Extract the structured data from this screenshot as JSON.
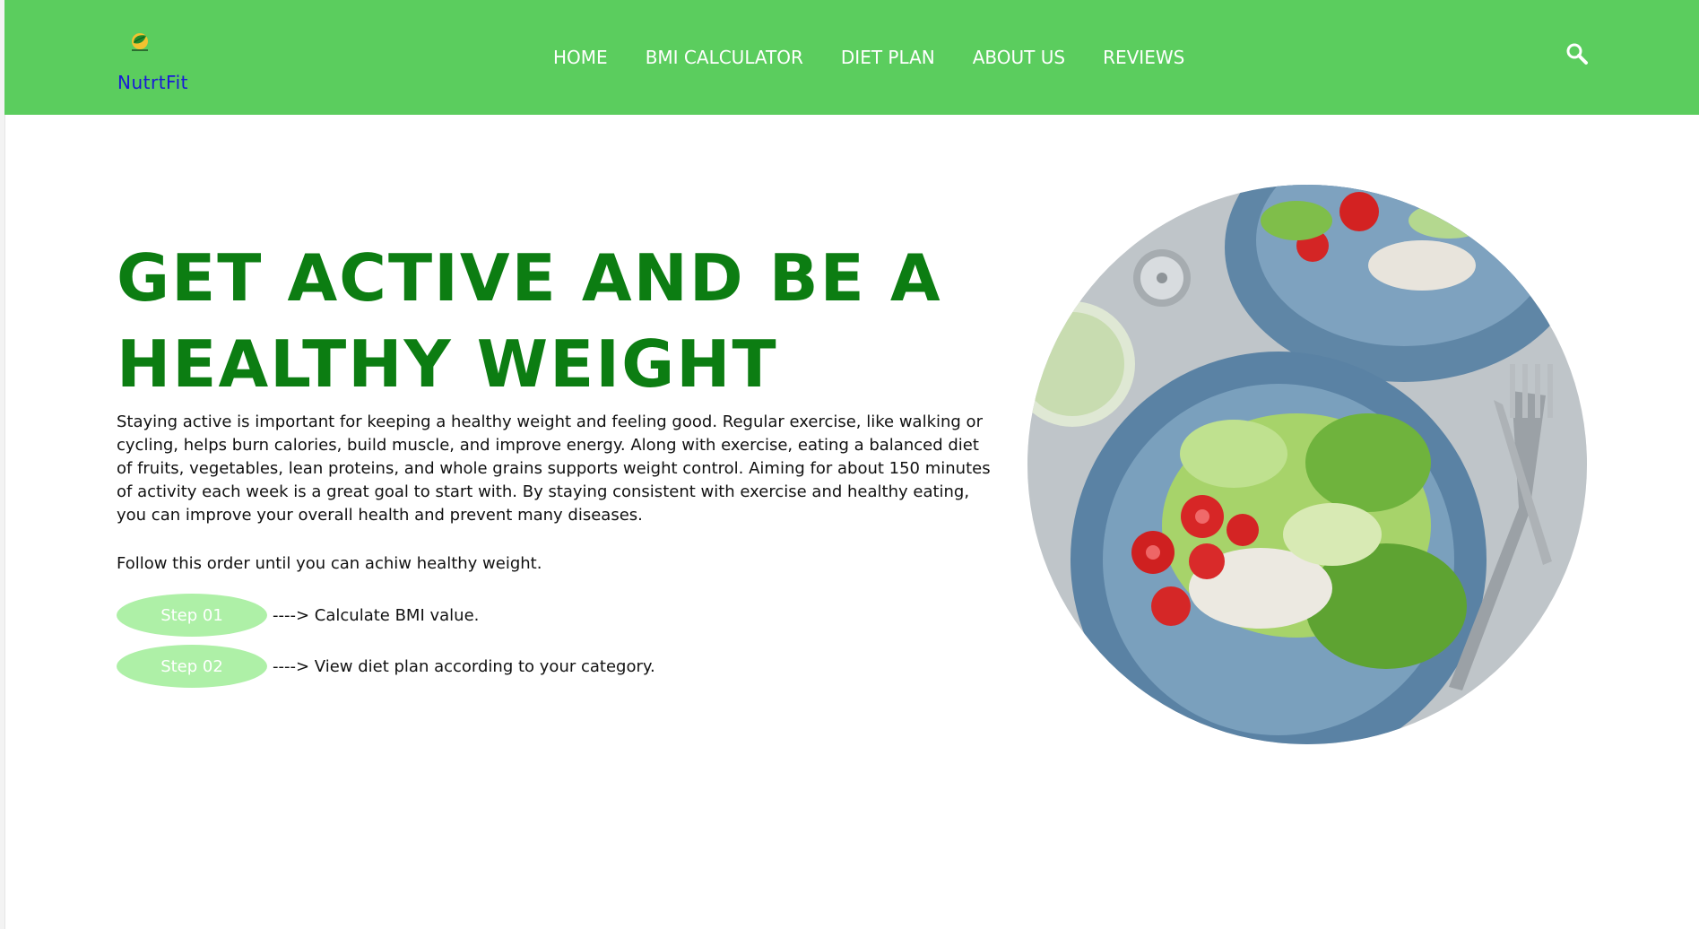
{
  "brand": {
    "name": "NutrtFit",
    "logo_icon": "leaf-logo-icon",
    "accent": "#5bcd5e",
    "title_color": "#0c7d12"
  },
  "nav": {
    "items": [
      {
        "label": "HOME"
      },
      {
        "label": "BMI CALCULATOR"
      },
      {
        "label": "DIET PLAN"
      },
      {
        "label": "ABOUT US"
      },
      {
        "label": "REVIEWS"
      }
    ],
    "search_icon": "search-icon"
  },
  "hero": {
    "title_line1": "GET ACTIVE AND BE A",
    "title_line2": "HEALTHY WEIGHT",
    "description": "Staying active is important for keeping a healthy weight and feeling good. Regular exercise, like walking or cycling, helps burn calories, build muscle, and improve energy. Along with exercise, eating a balanced diet of fruits, vegetables, lean proteins, and whole grains supports weight control. Aiming for about 150 minutes of activity each week is a great goal to start with. By staying consistent with exercise and healthy eating, you can improve your overall health and prevent many diseases.",
    "follow_text": "Follow this order until you can achiw healthy weight.",
    "steps": [
      {
        "label": "Step 01",
        "text": "----> Calculate BMI value."
      },
      {
        "label": "Step 02",
        "text": "----> View diet plan according to your category."
      }
    ],
    "image_icon": "salad-plate-image"
  }
}
